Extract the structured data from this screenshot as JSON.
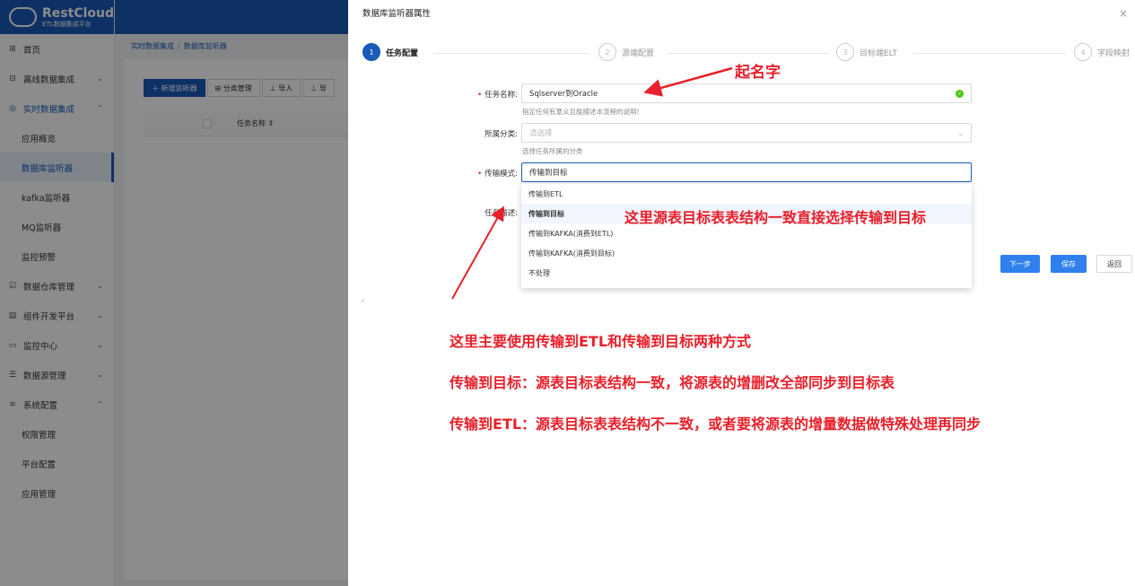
{
  "logo": {
    "name": "RestCloud",
    "subtitle": "ETL数据集成平台"
  },
  "sidebar": {
    "items": [
      {
        "icon": "home-icon",
        "glyph": "⊞",
        "label": "首页"
      },
      {
        "icon": "offline-icon",
        "glyph": "⊟",
        "label": "离线数据集成",
        "arrow": "⌄"
      },
      {
        "icon": "realtime-icon",
        "glyph": "◎",
        "label": "实时数据集成",
        "arrow": "⌃"
      },
      {
        "label": "应用概览"
      },
      {
        "label": "数据库监听器"
      },
      {
        "label": "kafka监听器"
      },
      {
        "label": "MQ监听器"
      },
      {
        "label": "监控预警"
      },
      {
        "icon": "warehouse-icon",
        "glyph": "☑",
        "label": "数据仓库管理",
        "arrow": "⌄"
      },
      {
        "icon": "component-icon",
        "glyph": "▤",
        "label": "组件开发平台",
        "arrow": "⌄"
      },
      {
        "icon": "monitor-icon",
        "glyph": "▭",
        "label": "监控中心",
        "arrow": "⌄"
      },
      {
        "icon": "datasource-icon",
        "glyph": "☰",
        "label": "数据源管理",
        "arrow": "⌄"
      },
      {
        "icon": "settings-icon",
        "glyph": "≋",
        "label": "系统配置",
        "arrow": "⌃"
      },
      {
        "label": "权限管理"
      },
      {
        "label": "平台配置"
      },
      {
        "label": "应用管理"
      }
    ]
  },
  "breadcrumb": {
    "parent": "实时数据集成",
    "sep": "/",
    "current": "数据库监听器"
  },
  "toolbar": {
    "add": "＋ 新增监听器",
    "category": "⊞ 分类管理",
    "import": "⊥ 导入",
    "export": "⊥ 导"
  },
  "table": {
    "col_name": "任务名称 ⇕"
  },
  "drawer": {
    "title": "数据库监听器属性",
    "close": "×",
    "steps": [
      {
        "num": "1",
        "label": "任务配置"
      },
      {
        "num": "2",
        "label": "源端配置"
      },
      {
        "num": "3",
        "label": "目标端ELT"
      },
      {
        "num": "4",
        "label": "字段映射"
      }
    ],
    "form": {
      "task_name_label": "任务名称:",
      "task_name_value": "Sqlserver到Oracle",
      "task_name_hint": "指定任何有意义且能描述本流程的说明!",
      "category_label": "所属分类:",
      "category_placeholder": "请选择",
      "category_hint": "选择任务所属的分类",
      "mode_label": "传输模式:",
      "mode_value": "传输到目标",
      "desc_label": "任务描述:"
    },
    "options": [
      "传输到ETL",
      "传输到目标",
      "传输到KAFKA(消费到ETL)",
      "传输到KAFKA(消费到目标)",
      "不处理"
    ],
    "buttons": {
      "next": "下一步",
      "save": "保存",
      "back": "返回"
    },
    "dot": ","
  },
  "annotations": {
    "name_note": "起名字",
    "option_note": "这里源表目标表表结构一致直接选择传输到目标",
    "line1": "这里主要使用传输到ETL和传输到目标两种方式",
    "line2": "传输到目标：源表目标表结构一致，将源表的增删改全部同步到目标表",
    "line3": "传输到ETL：源表目标表表结构不一致，或者要将源表的增量数据做特殊处理再同步",
    "color": "#e8202a"
  },
  "colors": {
    "brand": "#1a5ab8",
    "primary_button": "#2f80ed",
    "success": "#52c41a"
  }
}
